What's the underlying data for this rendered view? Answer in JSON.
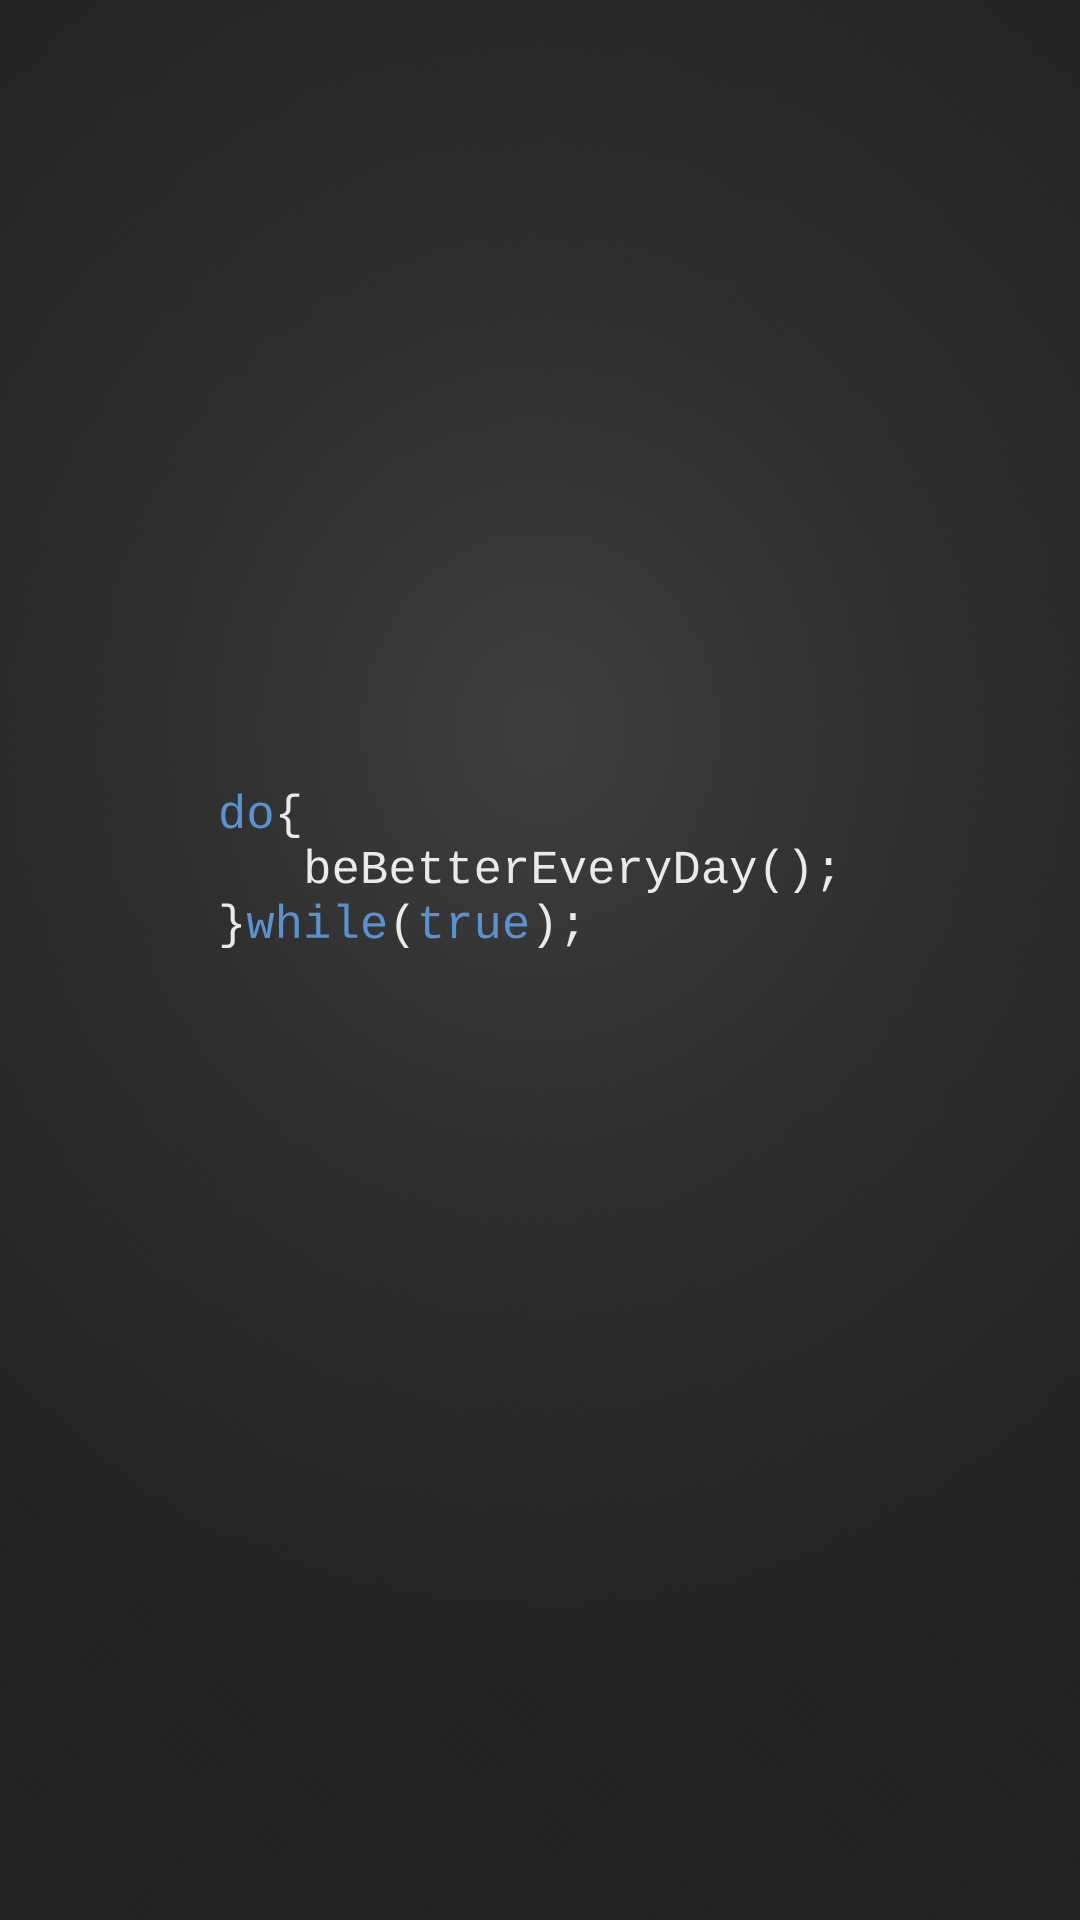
{
  "code": {
    "line1": {
      "keyword_do": "do",
      "brace_open": "{"
    },
    "line2": {
      "indent": "   ",
      "call": "beBetterEveryDay();"
    },
    "line3": {
      "brace_close": "}",
      "keyword_while": "while",
      "paren_open": "(",
      "literal_true": "true",
      "paren_close_semi": ");"
    }
  },
  "colors": {
    "keyword": "#5b91d1",
    "text": "#e8e8e8",
    "bg_center": "#3f3f3f",
    "bg_edge": "#232323"
  }
}
